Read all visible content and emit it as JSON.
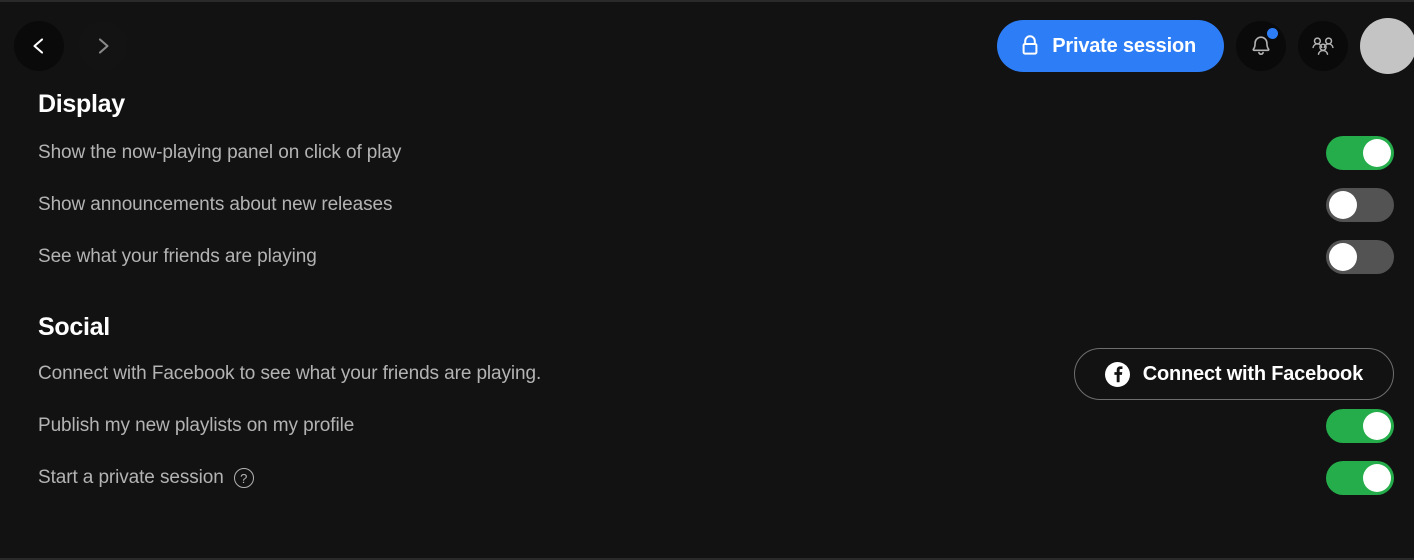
{
  "theme": {
    "background": "#121212",
    "accent_blue": "#2d7df6",
    "toggle_on_green": "#25ad4b",
    "toggle_off_gray": "#535353",
    "text_primary": "#ffffff",
    "text_secondary": "#b3b3b3",
    "avatar_color": "#c4c4c4"
  },
  "topbar": {
    "back_icon": "chevron-left-icon",
    "forward_icon": "chevron-right-icon",
    "private_session": {
      "label": "Private session",
      "icon": "lock-icon",
      "active": true
    },
    "notifications": {
      "icon": "bell-icon",
      "has_unread_badge": true
    },
    "friend_activity": {
      "icon": "friends-group-icon"
    },
    "avatar": {
      "icon": "avatar"
    }
  },
  "sections": [
    {
      "id": "display",
      "title": "Display",
      "rows": [
        {
          "label": "Show the now-playing panel on click of play",
          "control": "toggle",
          "state": "on"
        },
        {
          "label": "Show announcements about new releases",
          "control": "toggle",
          "state": "off"
        },
        {
          "label": "See what your friends are playing",
          "control": "toggle",
          "state": "off"
        }
      ]
    },
    {
      "id": "social",
      "title": "Social",
      "rows": [
        {
          "label": "Connect with Facebook to see what your friends are playing.",
          "control": "button",
          "button_label": "Connect with Facebook",
          "button_icon": "facebook-icon"
        },
        {
          "label": "Publish my new playlists on my profile",
          "control": "toggle",
          "state": "on"
        },
        {
          "label": "Start a private session",
          "help_icon": "?",
          "control": "toggle",
          "state": "on"
        }
      ]
    }
  ]
}
